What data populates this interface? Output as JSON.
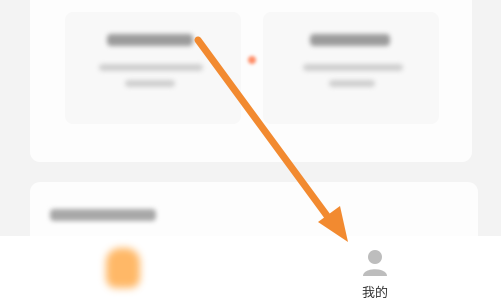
{
  "tabbar": {
    "tabs": [
      {
        "icon": "home-icon",
        "label": ""
      },
      {
        "icon": "person-icon",
        "label": "我的"
      }
    ]
  },
  "colors": {
    "arrow": "#f28a30",
    "home_accent": "#ffac4d"
  }
}
